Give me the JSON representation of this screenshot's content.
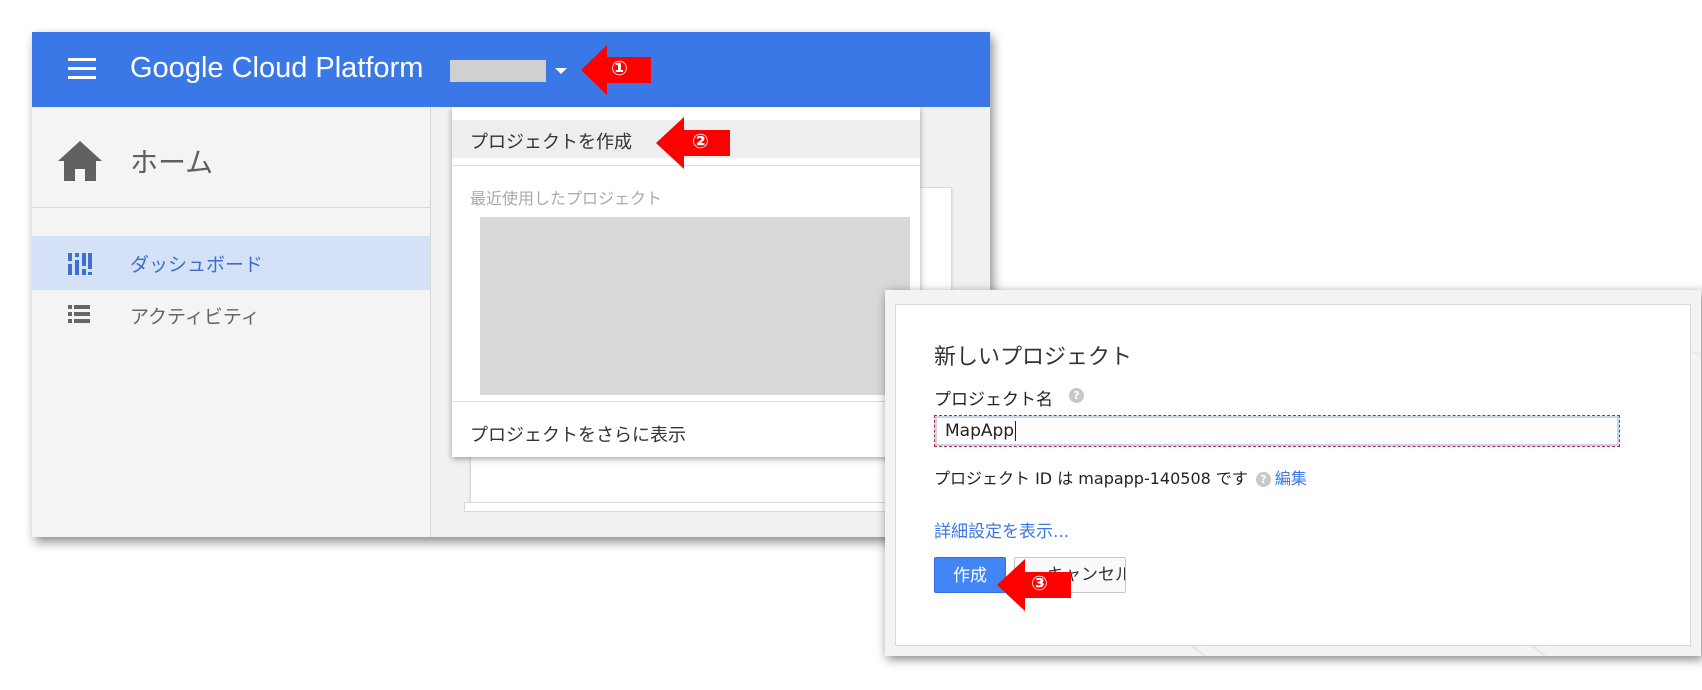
{
  "topbar": {
    "brand": "Google Cloud Platform",
    "color": "#3b78e7",
    "menu_icon": "hamburger-icon",
    "project_selector_icon": "caret-down-icon"
  },
  "sidebar": {
    "home": {
      "label": "ホーム",
      "icon": "home-icon"
    },
    "items": [
      {
        "label": "ダッシュボード",
        "icon": "dashboard-icon",
        "active": true
      },
      {
        "label": "アクティビティ",
        "icon": "list-icon",
        "active": false
      }
    ]
  },
  "project_menu": {
    "create_label": "プロジェクトを作成",
    "recent_heading": "最近使用したプロジェクト",
    "show_more_label": "プロジェクトをさらに表示"
  },
  "new_project_dialog": {
    "title": "新しいプロジェクト",
    "name_label": "プロジェクト名",
    "name_value": "MapApp",
    "project_id_text": "プロジェクト ID は mapapp-140508 です",
    "edit_label": "編集",
    "advanced_label": "詳細設定を表示...",
    "create_button": "作成",
    "cancel_button": "キャンセル",
    "help_icon": "help-icon"
  },
  "annotations": [
    {
      "number": "①",
      "color": "#ff0000"
    },
    {
      "number": "②",
      "color": "#ff0000"
    },
    {
      "number": "③",
      "color": "#ff0000"
    }
  ]
}
